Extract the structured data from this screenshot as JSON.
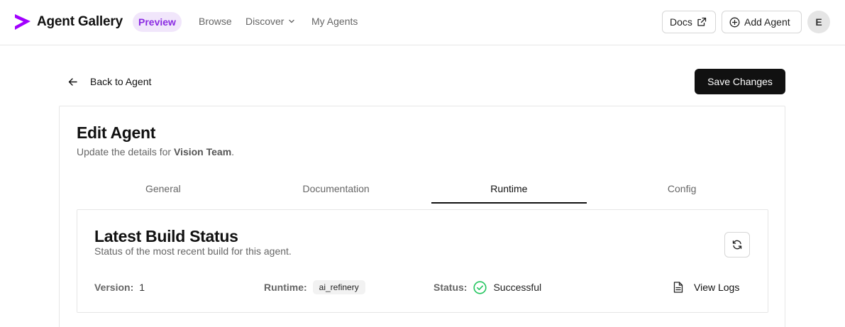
{
  "header": {
    "app_title": "Agent Gallery",
    "badge": "Preview",
    "nav": [
      {
        "label": "Browse"
      },
      {
        "label": "Discover"
      },
      {
        "label": "My Agents"
      }
    ],
    "docs_label": "Docs",
    "add_agent_label": "Add Agent",
    "avatar_initial": "E"
  },
  "toolbar": {
    "back_label": "Back to Agent",
    "save_label": "Save Changes"
  },
  "editor": {
    "title": "Edit Agent",
    "subtitle_prefix": "Update the details for ",
    "agent_name": "Vision Team",
    "subtitle_suffix": ".",
    "tabs": [
      {
        "label": "General"
      },
      {
        "label": "Documentation"
      },
      {
        "label": "Runtime"
      },
      {
        "label": "Config"
      }
    ],
    "active_tab": "Runtime"
  },
  "build": {
    "title": "Latest Build Status",
    "subtitle": "Status of the most recent build for this agent.",
    "version_label": "Version:",
    "version_value": "1",
    "runtime_label": "Runtime:",
    "runtime_value": "ai_refinery",
    "status_label": "Status:",
    "status_value": "Successful",
    "view_logs_label": "View Logs"
  },
  "icons": {
    "logo": "chevron-logo-icon",
    "discover_chevron": "chevron-down-icon",
    "docs": "external-link-icon",
    "add": "plus-circle-icon",
    "back": "arrow-left-icon",
    "refresh": "refresh-icon",
    "status": "check-circle-icon",
    "logs": "file-text-icon"
  },
  "colors": {
    "brand": "#a100ff",
    "badge_bg": "#f1e6fb",
    "badge_text": "#8a2be2",
    "primary_button": "#111111",
    "success": "#22c55e"
  }
}
